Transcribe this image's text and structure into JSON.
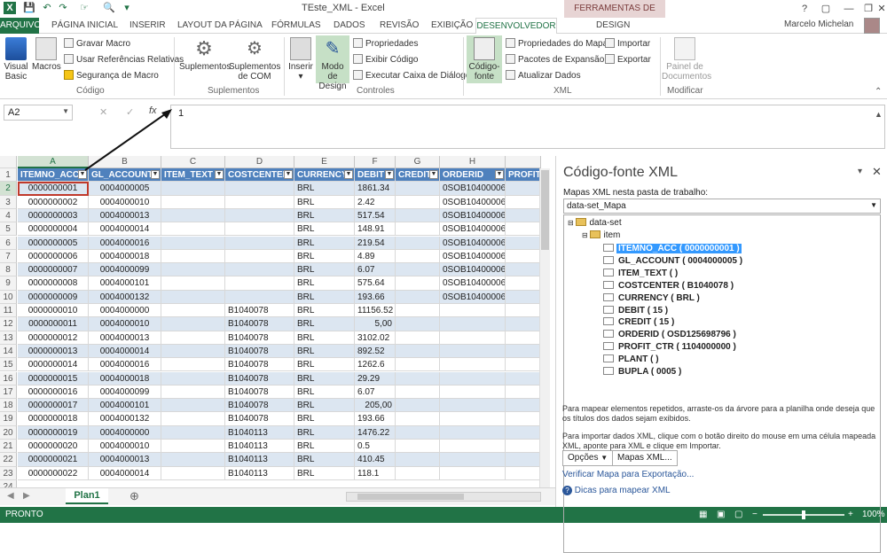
{
  "window": {
    "title": "TEste_XML - Excel",
    "tools_band": "FERRAMENTAS DE TABELA",
    "user": "Marcelo Michelan"
  },
  "tabs": [
    "ARQUIVO",
    "PÁGINA INICIAL",
    "INSERIR",
    "LAYOUT DA PÁGINA",
    "FÓRMULAS",
    "DADOS",
    "REVISÃO",
    "EXIBIÇÃO",
    "DESENVOLVEDOR",
    "DESIGN"
  ],
  "ribbon": {
    "codigo": {
      "visual_basic": "Visual Basic",
      "macros": "Macros",
      "gravar": "Gravar Macro",
      "usar_ref": "Usar Referências Relativas",
      "seguranca": "Segurança de Macro",
      "group": "Código"
    },
    "suplementos": {
      "sup": "Suplementos",
      "sup_com": "Suplementos de COM",
      "group": "Suplementos"
    },
    "controles": {
      "inserir": "Inserir",
      "modo": "Modo de Design",
      "propriedades": "Propriedades",
      "exibir_codigo": "Exibir Código",
      "executar": "Executar Caixa de Diálogo",
      "group": "Controles"
    },
    "xml": {
      "codigo_fonte": "Código-fonte",
      "prop_mapa": "Propriedades do Mapa",
      "pacotes": "Pacotes de Expansão",
      "atualizar": "Atualizar Dados",
      "importar": "Importar",
      "exportar": "Exportar",
      "group": "XML"
    },
    "modificar": {
      "painel": "Painel de Documentos",
      "group": "Modificar"
    }
  },
  "formula_bar": {
    "namebox": "A2",
    "fx": "fx",
    "value": "1"
  },
  "columns": [
    "A",
    "B",
    "C",
    "D",
    "E",
    "F",
    "G",
    "H"
  ],
  "headers": [
    "ITEMNO_ACC",
    "GL_ACCOUNT",
    "ITEM_TEXT",
    "COSTCENTER",
    "CURRENCY",
    "DEBIT",
    "CREDIT",
    "ORDERID",
    "PROFIT"
  ],
  "rows": [
    [
      "0000000001",
      "0004000005",
      "",
      "",
      "BRL",
      "1861.34",
      "",
      "0SOB10400006"
    ],
    [
      "0000000002",
      "0004000010",
      "",
      "",
      "BRL",
      "2.42",
      "",
      "0SOB10400006"
    ],
    [
      "0000000003",
      "0004000013",
      "",
      "",
      "BRL",
      "517.54",
      "",
      "0SOB10400006"
    ],
    [
      "0000000004",
      "0004000014",
      "",
      "",
      "BRL",
      "148.91",
      "",
      "0SOB10400006"
    ],
    [
      "0000000005",
      "0004000016",
      "",
      "",
      "BRL",
      "219.54",
      "",
      "0SOB10400006"
    ],
    [
      "0000000006",
      "0004000018",
      "",
      "",
      "BRL",
      "4.89",
      "",
      "0SOB10400006"
    ],
    [
      "0000000007",
      "0004000099",
      "",
      "",
      "BRL",
      "6.07",
      "",
      "0SOB10400006"
    ],
    [
      "0000000008",
      "0004000101",
      "",
      "",
      "BRL",
      "575.64",
      "",
      "0SOB10400006"
    ],
    [
      "0000000009",
      "0004000132",
      "",
      "",
      "BRL",
      "193.66",
      "",
      "0SOB10400006"
    ],
    [
      "0000000010",
      "0004000000",
      "",
      "B1040078",
      "BRL",
      "11156.52",
      "",
      ""
    ],
    [
      "0000000011",
      "0004000010",
      "",
      "B1040078",
      "BRL",
      "5,00",
      "",
      ""
    ],
    [
      "0000000012",
      "0004000013",
      "",
      "B1040078",
      "BRL",
      "3102.02",
      "",
      ""
    ],
    [
      "0000000013",
      "0004000014",
      "",
      "B1040078",
      "BRL",
      "892.52",
      "",
      ""
    ],
    [
      "0000000014",
      "0004000016",
      "",
      "B1040078",
      "BRL",
      "1262.6",
      "",
      ""
    ],
    [
      "0000000015",
      "0004000018",
      "",
      "B1040078",
      "BRL",
      "29.29",
      "",
      ""
    ],
    [
      "0000000016",
      "0004000099",
      "",
      "B1040078",
      "BRL",
      "6.07",
      "",
      ""
    ],
    [
      "0000000017",
      "0004000101",
      "",
      "B1040078",
      "BRL",
      "205,00",
      "",
      ""
    ],
    [
      "0000000018",
      "0004000132",
      "",
      "B1040078",
      "BRL",
      "193.66",
      "",
      ""
    ],
    [
      "0000000019",
      "0004000000",
      "",
      "B1040113",
      "BRL",
      "1476.22",
      "",
      ""
    ],
    [
      "0000000020",
      "0004000010",
      "",
      "B1040113",
      "BRL",
      "0.5",
      "",
      ""
    ],
    [
      "0000000021",
      "0004000013",
      "",
      "B1040113",
      "BRL",
      "410.45",
      "",
      ""
    ],
    [
      "0000000022",
      "0004000014",
      "",
      "B1040113",
      "BRL",
      "118.1",
      "",
      ""
    ]
  ],
  "sheet": {
    "tab": "Plan1",
    "status": "PRONTO",
    "zoom": "100%"
  },
  "pane": {
    "title": "Código-fonte XML",
    "maps_label": "Mapas XML nesta pasta de trabalho:",
    "map_selected": "data-set_Mapa",
    "tree": {
      "root": "data-set",
      "item": "item",
      "fields": [
        "ITEMNO_ACC ( 0000000001 )",
        "GL_ACCOUNT ( 0004000005 )",
        "ITEM_TEXT ( )",
        "COSTCENTER ( B1040078 )",
        "CURRENCY ( BRL )",
        "DEBIT ( 15 )",
        "CREDIT ( 15 )",
        "ORDERID ( OSD125698796 )",
        "PROFIT_CTR ( 1104000000 )",
        "PLANT ( )",
        "BUPLA ( 0005 )"
      ]
    },
    "help1": "Para mapear elementos repetidos, arraste-os da árvore para a planilha onde deseja que os títulos dos dados sejam exibidos.",
    "help2": "Para importar dados XML, clique com o botão direito do mouse em uma célula mapeada XML, aponte para XML e clique em Importar.",
    "opcoes": "Opções",
    "mapas": "Mapas XML...",
    "verificar": "Verificar Mapa para Exportação...",
    "dicas": "Dicas para mapear XML"
  }
}
